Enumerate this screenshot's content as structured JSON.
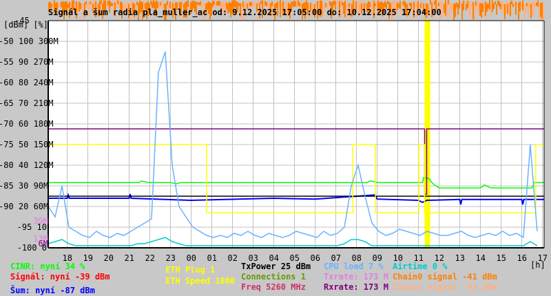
{
  "title": "Signál a šum radia pla_muller_ac od: 9.12.2025 17:05:00 do: 10.12.2025 17:04:00",
  "chart_data": {
    "type": "line",
    "title": "Signál a šum radia pla_muller_ac od: 9.12.2025 17:05:00 do: 10.12.2025 17:04:00",
    "xlabel": "[h]",
    "ylabel": "[dBm] [%]",
    "xlim_hours": [
      17.083,
      41.067
    ],
    "ylim": [
      -100,
      -45
    ],
    "grid": true,
    "x_ticks": [
      "18",
      "19",
      "20",
      "21",
      "22",
      "23",
      "00",
      "01",
      "02",
      "03",
      "04",
      "05",
      "06",
      "07",
      "08",
      "09",
      "10",
      "11",
      "12",
      "13",
      "14",
      "15",
      "16",
      "17"
    ],
    "y_ticks": [
      {
        "dbm": "-45",
        "pct": "",
        "rate": ""
      },
      {
        "dbm": "-50",
        "pct": "100",
        "rate": "300M"
      },
      {
        "dbm": "-55",
        "pct": "90",
        "rate": "270M"
      },
      {
        "dbm": "-60",
        "pct": "80",
        "rate": "240M"
      },
      {
        "dbm": "-65",
        "pct": "70",
        "rate": "210M"
      },
      {
        "dbm": "-70",
        "pct": "60",
        "rate": "180M"
      },
      {
        "dbm": "-75",
        "pct": "50",
        "rate": "150M"
      },
      {
        "dbm": "-80",
        "pct": "40",
        "rate": "120M"
      },
      {
        "dbm": "-85",
        "pct": "30",
        "rate": "90M"
      },
      {
        "dbm": "-90",
        "pct": "20",
        "rate": "60M"
      },
      {
        "dbm": "-95",
        "pct": "10",
        "rate": ""
      },
      {
        "dbm": "-100",
        "pct": "0",
        "rate": ""
      }
    ],
    "extra_ticks": [
      {
        "label": "39M",
        "color": "#e080e0",
        "value": -93.5
      },
      {
        "label": "13M",
        "color": "#e080e0",
        "value": -97.8
      },
      {
        "label": "6M",
        "color": "#800080",
        "value": -99
      }
    ],
    "series": [
      {
        "name": "CINR",
        "color": "#00ff00",
        "points": [
          [
            17.083,
            -84.2
          ],
          [
            21.5,
            -84.2
          ],
          [
            21.6,
            -83.8
          ],
          [
            21.9,
            -84.2
          ],
          [
            23.0,
            -84.2
          ],
          [
            23.3,
            -84.5
          ],
          [
            23.5,
            -84.2
          ],
          [
            32.5,
            -84.2
          ],
          [
            32.7,
            -83.8
          ],
          [
            33.0,
            -84.2
          ],
          [
            35.2,
            -84.2
          ],
          [
            35.25,
            -83
          ],
          [
            35.5,
            -83.2
          ],
          [
            35.7,
            -84.5
          ],
          [
            36.0,
            -85.5
          ],
          [
            38.0,
            -85.5
          ],
          [
            38.2,
            -84.8
          ],
          [
            38.5,
            -85.5
          ],
          [
            40.5,
            -85.5
          ],
          [
            40.6,
            -84.2
          ],
          [
            41.067,
            -84.2
          ]
        ]
      },
      {
        "name": "Šum",
        "color": "#0000ff",
        "points": [
          [
            17.083,
            -88
          ],
          [
            18.0,
            -88
          ],
          [
            18.05,
            -87.2
          ],
          [
            18.1,
            -88
          ],
          [
            21.0,
            -88
          ],
          [
            21.05,
            -87
          ],
          [
            21.1,
            -88
          ],
          [
            24.0,
            -88.5
          ],
          [
            28.0,
            -88
          ],
          [
            30.0,
            -88.2
          ],
          [
            32.9,
            -87.2
          ],
          [
            33.0,
            -88.2
          ],
          [
            35.0,
            -88.5
          ],
          [
            35.2,
            -89
          ],
          [
            35.4,
            -88.5
          ],
          [
            37.0,
            -88.3
          ],
          [
            37.05,
            -89.5
          ],
          [
            37.1,
            -88.3
          ],
          [
            40.0,
            -88.3
          ],
          [
            40.05,
            -89.5
          ],
          [
            40.1,
            -88.3
          ],
          [
            41.067,
            -88.3
          ]
        ]
      },
      {
        "name": "TxPower",
        "color": "#000000",
        "points": [
          [
            17.083,
            -87.5
          ],
          [
            41.067,
            -87.5
          ]
        ]
      },
      {
        "name": "Rxrate",
        "color": "#800080",
        "points": [
          [
            17.083,
            -71.2
          ],
          [
            35.3,
            -71.2
          ],
          [
            35.3,
            -87
          ],
          [
            35.4,
            -87
          ],
          [
            35.4,
            -71.2
          ],
          [
            41.067,
            -71.2
          ]
        ]
      },
      {
        "name": "ETH Speed",
        "color": "#ffff00",
        "points": [
          [
            17.083,
            -75
          ],
          [
            24.75,
            -75
          ],
          [
            24.75,
            -91.5
          ],
          [
            31.82,
            -91.5
          ],
          [
            31.82,
            -75
          ],
          [
            32.92,
            -75
          ],
          [
            32.92,
            -91.5
          ],
          [
            35.02,
            -91.5
          ],
          [
            35.02,
            -75
          ],
          [
            35.3,
            -75
          ],
          [
            35.3,
            -91.5
          ],
          [
            40.68,
            -91.5
          ],
          [
            40.68,
            -75
          ],
          [
            41.067,
            -75
          ]
        ]
      },
      {
        "name": "CPU load",
        "color": "#66b3ff",
        "unit": "%",
        "step_hours": 0.3333,
        "values": [
          20,
          15,
          30,
          10,
          8,
          6,
          5,
          8,
          6,
          5,
          7,
          6,
          8,
          10,
          12,
          14,
          85,
          95,
          40,
          20,
          15,
          10,
          8,
          6,
          5,
          6,
          5,
          7,
          6,
          8,
          6,
          5,
          7,
          6,
          5,
          6,
          8,
          7,
          6,
          5,
          8,
          6,
          7,
          10,
          30,
          40,
          25,
          12,
          8,
          6,
          7,
          9,
          8,
          7,
          6,
          8,
          7,
          6,
          6,
          7,
          8,
          6,
          5,
          6,
          7,
          6,
          8,
          6,
          7,
          5,
          50,
          8
        ]
      },
      {
        "name": "Airtime",
        "color": "#00cccc",
        "unit": "%",
        "step_hours": 0.3333,
        "values": [
          2,
          3,
          4,
          2,
          1,
          1,
          1,
          1,
          1,
          1,
          1,
          1,
          1,
          2,
          2,
          3,
          4,
          5,
          3,
          2,
          1,
          1,
          1,
          1,
          1,
          1,
          1,
          1,
          1,
          1,
          1,
          1,
          1,
          1,
          1,
          1,
          1,
          1,
          1,
          1,
          1,
          1,
          1,
          2,
          4,
          4,
          3,
          1,
          1,
          1,
          1,
          1,
          1,
          1,
          1,
          1,
          1,
          1,
          1,
          1,
          1,
          1,
          1,
          1,
          1,
          1,
          1,
          1,
          1,
          1,
          3,
          1
        ]
      }
    ],
    "eth_plug_band_hours": [
      35.3,
      35.57
    ]
  },
  "legend": {
    "cinr": {
      "text": "CINR: nyní 34 %",
      "color": "#00ff00"
    },
    "signal": {
      "text": "Signál: nyní -39 dBm",
      "color": "#ff0000"
    },
    "noise": {
      "text": "Šum: nyní -87 dBm",
      "color": "#0000ff"
    },
    "eth_plug": {
      "text": "ETH Plug 1",
      "color": "#ffff00"
    },
    "eth_speed": {
      "text": "ETH Speed 1000",
      "color": "#ffff00"
    },
    "txpower": {
      "text": "TxPower 25 dBm",
      "color": "#000000"
    },
    "connections": {
      "text": "Connections 1",
      "color": "#669900"
    },
    "freq": {
      "text": "Freq 5260 MHz",
      "color": "#cc3366"
    },
    "cpu": {
      "text": "CPU load 7 %",
      "color": "#66b3ff"
    },
    "txrate": {
      "text": "Txrate: 173 M",
      "color": "#e080e0"
    },
    "rxrate": {
      "text": "Rxrate: 173 M",
      "color": "#800080"
    },
    "airtime": {
      "text": "Airtime 0 %",
      "color": "#00cccc"
    },
    "chain0": {
      "text": "Chain0 signal -41 dBm",
      "color": "#ff8000"
    },
    "chain1": {
      "text": "Chain1 signal -43 dBm",
      "color": "#ffb080"
    },
    "unit_h": "[h]"
  }
}
